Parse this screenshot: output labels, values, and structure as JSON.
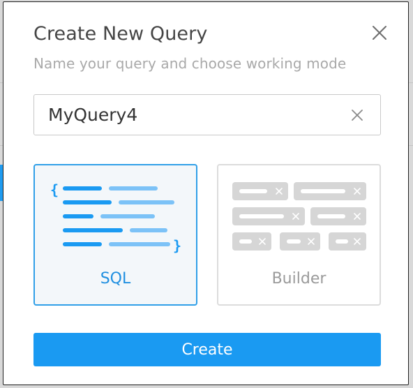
{
  "dialog": {
    "title": "Create New Query",
    "subtitle": "Name your query and choose working mode",
    "close_icon": "close-icon"
  },
  "name_field": {
    "value": "MyQuery4",
    "clear_icon": "clear-icon"
  },
  "modes": [
    {
      "id": "sql",
      "label": "SQL",
      "selected": true,
      "icon": "code-lines-icon"
    },
    {
      "id": "builder",
      "label": "Builder",
      "selected": false,
      "icon": "query-builder-chips-icon"
    }
  ],
  "actions": {
    "create_label": "Create"
  },
  "colors": {
    "accent": "#1a9af2",
    "accent_light": "#7cc2f7",
    "text_primary": "#454545",
    "text_muted": "#a9a9a9",
    "chip_gray": "#d6d6d6"
  }
}
